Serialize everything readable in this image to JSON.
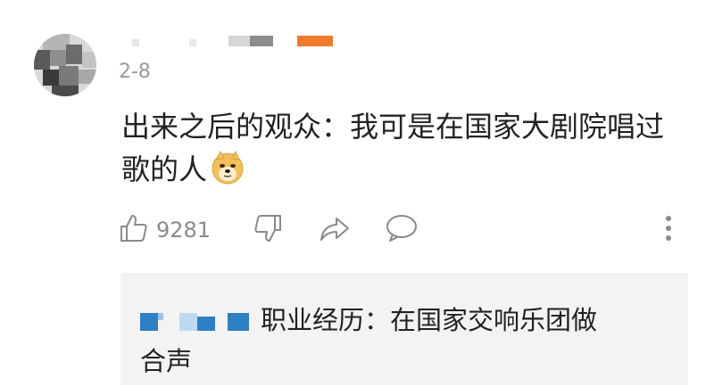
{
  "comment": {
    "date": "2-8",
    "text_line1": "出来之后的观众：我可是在国家大剧院唱过",
    "text_line2": "歌的人",
    "emoji": "doge-emoji",
    "like_count": "9281"
  },
  "reply": {
    "text_line1": "职业经历：在国家交响乐团做",
    "text_line2": "合声"
  },
  "icons": {
    "like": "thumbs-up-icon",
    "dislike": "thumbs-down-icon",
    "share": "share-icon",
    "comment": "comment-icon",
    "more": "more-vertical-icon"
  },
  "colors": {
    "accent": "#f07a2e",
    "reply_name": "#2f7fc4",
    "reply_bg": "#f3f3f3"
  }
}
